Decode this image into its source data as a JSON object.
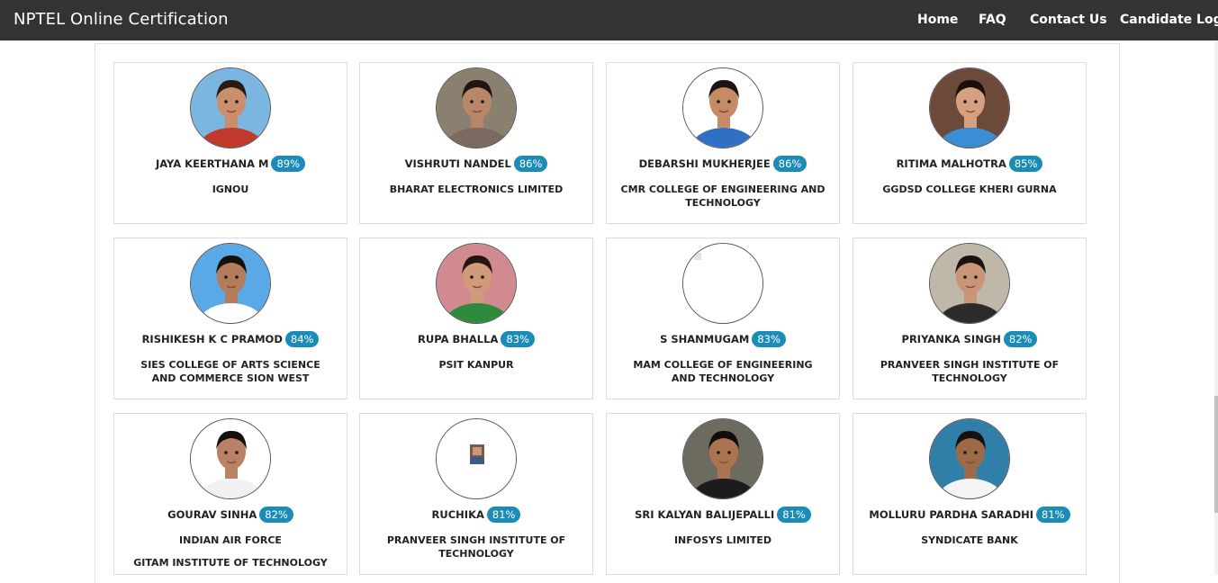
{
  "header": {
    "brand": "NPTEL Online Certification",
    "nav": [
      "Home",
      "FAQ",
      "Contact Us",
      "Candidate Login"
    ]
  },
  "colors": {
    "navbar": "#333333",
    "badge": "#1b8cb8"
  },
  "toppers": [
    {
      "name": "JAYA KEERTHANA M",
      "score": "89%",
      "org": "IGNOU",
      "org2": ""
    },
    {
      "name": "VISHRUTI NANDEL",
      "score": "86%",
      "org": "BHARAT ELECTRONICS LIMITED",
      "org2": ""
    },
    {
      "name": "DEBARSHI MUKHERJEE",
      "score": "86%",
      "org": "CMR COLLEGE OF ENGINEERING AND TECHNOLOGY",
      "org2": ""
    },
    {
      "name": "RITIMA MALHOTRA",
      "score": "85%",
      "org": "GGDSD COLLEGE KHERI GURNA",
      "org2": ""
    },
    {
      "name": "RISHIKESH K C PRAMOD",
      "score": "84%",
      "org": "SIES COLLEGE OF ARTS SCIENCE AND COMMERCE SION WEST",
      "org2": ""
    },
    {
      "name": "RUPA BHALLA",
      "score": "83%",
      "org": "PSIT KANPUR",
      "org2": ""
    },
    {
      "name": "S SHANMUGAM",
      "score": "83%",
      "org": "MAM COLLEGE OF ENGINEERING AND TECHNOLOGY",
      "org2": ""
    },
    {
      "name": "PRIYANKA SINGH",
      "score": "82%",
      "org": "PRANVEER SINGH INSTITUTE OF TECHNOLOGY",
      "org2": ""
    },
    {
      "name": "GOURAV SINHA",
      "score": "82%",
      "org": "INDIAN AIR FORCE",
      "org2": "GITAM INSTITUTE OF TECHNOLOGY"
    },
    {
      "name": "RUCHIKA",
      "score": "81%",
      "org": "PRANVEER SINGH INSTITUTE OF TECHNOLOGY",
      "org2": ""
    },
    {
      "name": "SRI KALYAN BALIJEPALLI",
      "score": "81%",
      "org": "INFOSYS LIMITED",
      "org2": ""
    },
    {
      "name": "MOLLURU PARDHA SARADHI",
      "score": "81%",
      "org": "SYNDICATE BANK",
      "org2": ""
    }
  ]
}
